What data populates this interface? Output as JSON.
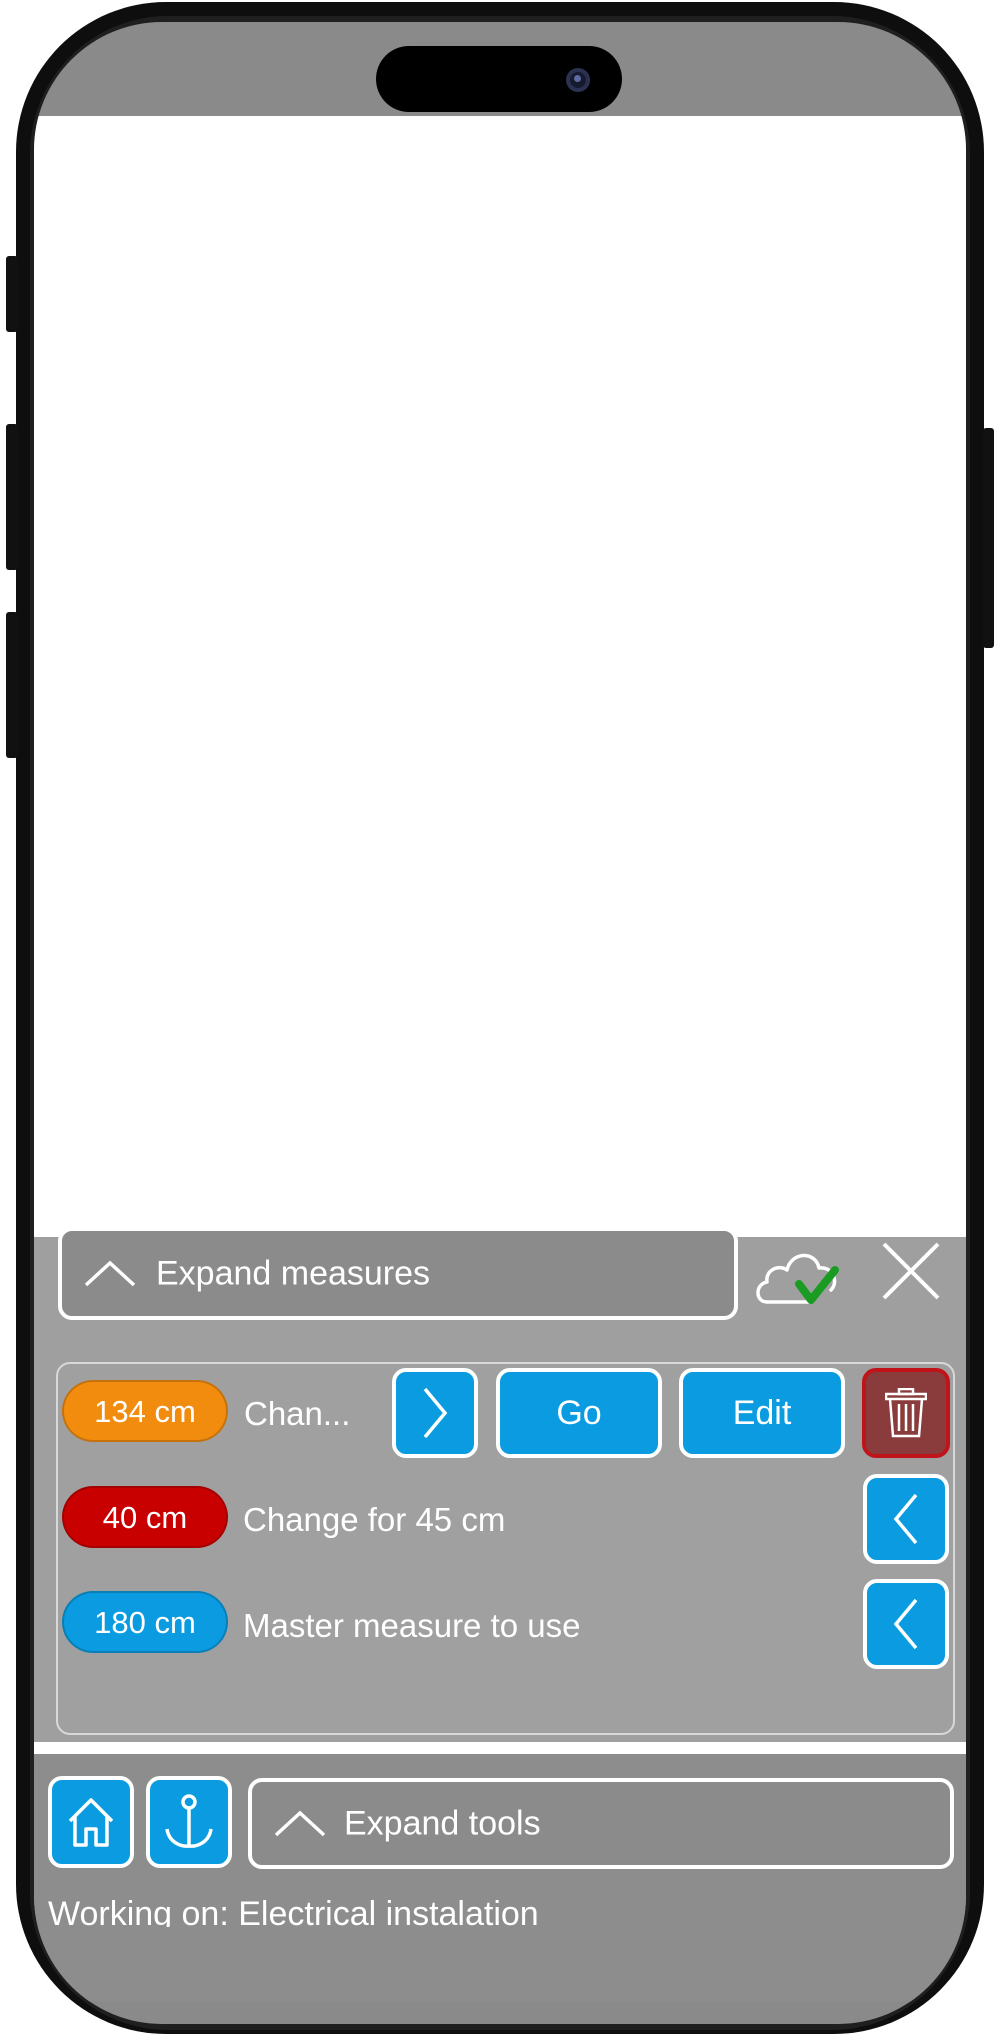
{
  "measures_panel": {
    "expand_label": "Expand measures",
    "cloud_status_icon": "cloud-check-icon",
    "close_icon": "close-icon"
  },
  "measures": [
    {
      "value": "134 cm",
      "label": "Chan...",
      "color": "#f28c0f",
      "selected": true
    },
    {
      "value": "40 cm",
      "label": "Change for 45 cm",
      "color": "#c90000",
      "selected": false
    },
    {
      "value": "180 cm",
      "label": "Master measure to use",
      "color": "#0a9be0",
      "selected": false
    }
  ],
  "actions": {
    "go_label": "Go",
    "edit_label": "Edit",
    "delete_icon": "trash-icon",
    "open_icon": "chevron-right-icon",
    "select_icon": "chevron-left-icon"
  },
  "toolbar": {
    "home_icon": "home-icon",
    "anchor_icon": "anchor-icon",
    "expand_tools_label": "Expand tools",
    "status": "Working on: Electrical instalation"
  },
  "colors": {
    "accent_blue": "#0a9be0",
    "panel_gray": "#9f9f9f",
    "delete_red": "#c0141a"
  }
}
